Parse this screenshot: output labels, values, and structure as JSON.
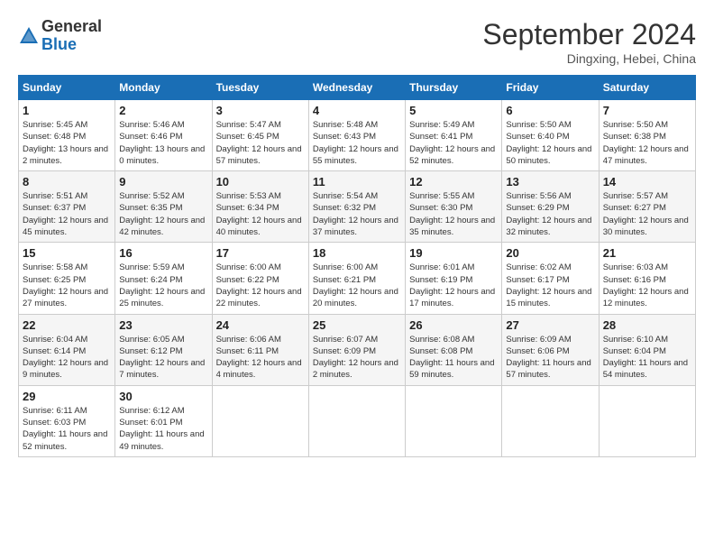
{
  "logo": {
    "general": "General",
    "blue": "Blue"
  },
  "header": {
    "month": "September 2024",
    "location": "Dingxing, Hebei, China"
  },
  "days_of_week": [
    "Sunday",
    "Monday",
    "Tuesday",
    "Wednesday",
    "Thursday",
    "Friday",
    "Saturday"
  ],
  "weeks": [
    [
      {
        "day": 1,
        "sunrise": "5:45 AM",
        "sunset": "6:48 PM",
        "daylight": "13 hours and 2 minutes."
      },
      {
        "day": 2,
        "sunrise": "5:46 AM",
        "sunset": "6:46 PM",
        "daylight": "13 hours and 0 minutes."
      },
      {
        "day": 3,
        "sunrise": "5:47 AM",
        "sunset": "6:45 PM",
        "daylight": "12 hours and 57 minutes."
      },
      {
        "day": 4,
        "sunrise": "5:48 AM",
        "sunset": "6:43 PM",
        "daylight": "12 hours and 55 minutes."
      },
      {
        "day": 5,
        "sunrise": "5:49 AM",
        "sunset": "6:41 PM",
        "daylight": "12 hours and 52 minutes."
      },
      {
        "day": 6,
        "sunrise": "5:50 AM",
        "sunset": "6:40 PM",
        "daylight": "12 hours and 50 minutes."
      },
      {
        "day": 7,
        "sunrise": "5:50 AM",
        "sunset": "6:38 PM",
        "daylight": "12 hours and 47 minutes."
      }
    ],
    [
      {
        "day": 8,
        "sunrise": "5:51 AM",
        "sunset": "6:37 PM",
        "daylight": "12 hours and 45 minutes."
      },
      {
        "day": 9,
        "sunrise": "5:52 AM",
        "sunset": "6:35 PM",
        "daylight": "12 hours and 42 minutes."
      },
      {
        "day": 10,
        "sunrise": "5:53 AM",
        "sunset": "6:34 PM",
        "daylight": "12 hours and 40 minutes."
      },
      {
        "day": 11,
        "sunrise": "5:54 AM",
        "sunset": "6:32 PM",
        "daylight": "12 hours and 37 minutes."
      },
      {
        "day": 12,
        "sunrise": "5:55 AM",
        "sunset": "6:30 PM",
        "daylight": "12 hours and 35 minutes."
      },
      {
        "day": 13,
        "sunrise": "5:56 AM",
        "sunset": "6:29 PM",
        "daylight": "12 hours and 32 minutes."
      },
      {
        "day": 14,
        "sunrise": "5:57 AM",
        "sunset": "6:27 PM",
        "daylight": "12 hours and 30 minutes."
      }
    ],
    [
      {
        "day": 15,
        "sunrise": "5:58 AM",
        "sunset": "6:25 PM",
        "daylight": "12 hours and 27 minutes."
      },
      {
        "day": 16,
        "sunrise": "5:59 AM",
        "sunset": "6:24 PM",
        "daylight": "12 hours and 25 minutes."
      },
      {
        "day": 17,
        "sunrise": "6:00 AM",
        "sunset": "6:22 PM",
        "daylight": "12 hours and 22 minutes."
      },
      {
        "day": 18,
        "sunrise": "6:00 AM",
        "sunset": "6:21 PM",
        "daylight": "12 hours and 20 minutes."
      },
      {
        "day": 19,
        "sunrise": "6:01 AM",
        "sunset": "6:19 PM",
        "daylight": "12 hours and 17 minutes."
      },
      {
        "day": 20,
        "sunrise": "6:02 AM",
        "sunset": "6:17 PM",
        "daylight": "12 hours and 15 minutes."
      },
      {
        "day": 21,
        "sunrise": "6:03 AM",
        "sunset": "6:16 PM",
        "daylight": "12 hours and 12 minutes."
      }
    ],
    [
      {
        "day": 22,
        "sunrise": "6:04 AM",
        "sunset": "6:14 PM",
        "daylight": "12 hours and 9 minutes."
      },
      {
        "day": 23,
        "sunrise": "6:05 AM",
        "sunset": "6:12 PM",
        "daylight": "12 hours and 7 minutes."
      },
      {
        "day": 24,
        "sunrise": "6:06 AM",
        "sunset": "6:11 PM",
        "daylight": "12 hours and 4 minutes."
      },
      {
        "day": 25,
        "sunrise": "6:07 AM",
        "sunset": "6:09 PM",
        "daylight": "12 hours and 2 minutes."
      },
      {
        "day": 26,
        "sunrise": "6:08 AM",
        "sunset": "6:08 PM",
        "daylight": "11 hours and 59 minutes."
      },
      {
        "day": 27,
        "sunrise": "6:09 AM",
        "sunset": "6:06 PM",
        "daylight": "11 hours and 57 minutes."
      },
      {
        "day": 28,
        "sunrise": "6:10 AM",
        "sunset": "6:04 PM",
        "daylight": "11 hours and 54 minutes."
      }
    ],
    [
      {
        "day": 29,
        "sunrise": "6:11 AM",
        "sunset": "6:03 PM",
        "daylight": "11 hours and 52 minutes."
      },
      {
        "day": 30,
        "sunrise": "6:12 AM",
        "sunset": "6:01 PM",
        "daylight": "11 hours and 49 minutes."
      },
      null,
      null,
      null,
      null,
      null
    ]
  ]
}
